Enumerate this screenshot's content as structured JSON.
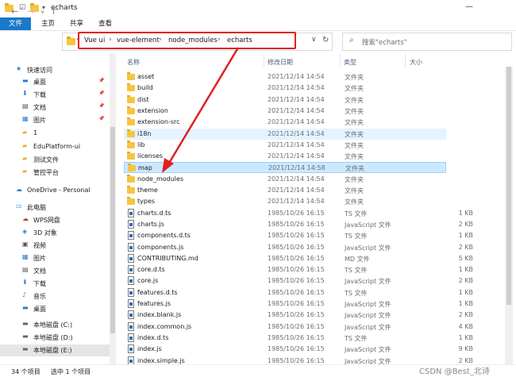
{
  "window": {
    "title": "echarts"
  },
  "ribbon": {
    "tabs": [
      "文件",
      "主页",
      "共享",
      "查看"
    ]
  },
  "address": {
    "crumbs": [
      "Vue ui",
      "vue-element",
      "node_modules",
      "echarts"
    ],
    "search_placeholder": "搜索\"echarts\""
  },
  "sidebar": {
    "items": [
      {
        "label": "快速访问",
        "icon": "star-icon",
        "pin": false
      },
      {
        "label": "桌面",
        "icon": "desktop-icon",
        "pin": true
      },
      {
        "label": "下载",
        "icon": "download-icon",
        "pin": true
      },
      {
        "label": "文档",
        "icon": "document-icon",
        "pin": true
      },
      {
        "label": "图片",
        "icon": "picture-icon",
        "pin": true
      },
      {
        "label": "1",
        "icon": "folder-icon",
        "pin": false
      },
      {
        "label": "EduPlatform-ui",
        "icon": "folder-icon",
        "pin": false
      },
      {
        "label": "测试文件",
        "icon": "folder-icon",
        "pin": false
      },
      {
        "label": "管控平台",
        "icon": "folder-icon",
        "pin": false
      },
      {
        "label": "OneDrive - Personal",
        "icon": "cloud-icon",
        "pin": false
      },
      {
        "label": "此电脑",
        "icon": "computer-icon",
        "pin": false
      },
      {
        "label": "WPS网盘",
        "icon": "cloud-drive-icon",
        "pin": false
      },
      {
        "label": "3D 对象",
        "icon": "cube-icon",
        "pin": false
      },
      {
        "label": "视频",
        "icon": "video-icon",
        "pin": false
      },
      {
        "label": "图片",
        "icon": "picture-icon",
        "pin": false
      },
      {
        "label": "文档",
        "icon": "document-icon",
        "pin": false
      },
      {
        "label": "下载",
        "icon": "download-icon",
        "pin": false
      },
      {
        "label": "音乐",
        "icon": "music-icon",
        "pin": false
      },
      {
        "label": "桌面",
        "icon": "desktop-icon",
        "pin": false
      },
      {
        "label": "本地磁盘 (C:)",
        "icon": "drive-icon",
        "pin": false
      },
      {
        "label": "本地磁盘 (D:)",
        "icon": "drive-icon",
        "pin": false
      },
      {
        "label": "本地磁盘 (E:)",
        "icon": "drive-icon",
        "pin": false
      }
    ]
  },
  "columns": {
    "name": "名称",
    "date": "修改日期",
    "type": "类型",
    "size": "大小"
  },
  "files": [
    {
      "name": "asset",
      "date": "2021/12/14 14:54",
      "type": "文件夹",
      "size": "",
      "kind": "folder"
    },
    {
      "name": "build",
      "date": "2021/12/14 14:54",
      "type": "文件夹",
      "size": "",
      "kind": "folder"
    },
    {
      "name": "dist",
      "date": "2021/12/14 14:54",
      "type": "文件夹",
      "size": "",
      "kind": "folder"
    },
    {
      "name": "extension",
      "date": "2021/12/14 14:54",
      "type": "文件夹",
      "size": "",
      "kind": "folder"
    },
    {
      "name": "extension-src",
      "date": "2021/12/14 14:54",
      "type": "文件夹",
      "size": "",
      "kind": "folder"
    },
    {
      "name": "i18n",
      "date": "2021/12/14 14:54",
      "type": "文件夹",
      "size": "",
      "kind": "folder",
      "state": "hover"
    },
    {
      "name": "lib",
      "date": "2021/12/14 14:54",
      "type": "文件夹",
      "size": "",
      "kind": "folder"
    },
    {
      "name": "licenses",
      "date": "2021/12/14 14:54",
      "type": "文件夹",
      "size": "",
      "kind": "folder"
    },
    {
      "name": "map",
      "date": "2021/12/14 14:58",
      "type": "文件夹",
      "size": "",
      "kind": "folder",
      "state": "selected"
    },
    {
      "name": "node_modules",
      "date": "2021/12/14 14:54",
      "type": "文件夹",
      "size": "",
      "kind": "folder"
    },
    {
      "name": "theme",
      "date": "2021/12/14 14:54",
      "type": "文件夹",
      "size": "",
      "kind": "folder"
    },
    {
      "name": "types",
      "date": "2021/12/14 14:54",
      "type": "文件夹",
      "size": "",
      "kind": "folder"
    },
    {
      "name": "charts.d.ts",
      "date": "1985/10/26 16:15",
      "type": "TS 文件",
      "size": "1 KB",
      "kind": "file"
    },
    {
      "name": "charts.js",
      "date": "1985/10/26 16:15",
      "type": "JavaScript 文件",
      "size": "2 KB",
      "kind": "file"
    },
    {
      "name": "components.d.ts",
      "date": "1985/10/26 16:15",
      "type": "TS 文件",
      "size": "1 KB",
      "kind": "file"
    },
    {
      "name": "components.js",
      "date": "1985/10/26 16:15",
      "type": "JavaScript 文件",
      "size": "2 KB",
      "kind": "file"
    },
    {
      "name": "CONTRIBUTING.md",
      "date": "1985/10/26 16:15",
      "type": "MD 文件",
      "size": "5 KB",
      "kind": "file"
    },
    {
      "name": "core.d.ts",
      "date": "1985/10/26 16:15",
      "type": "TS 文件",
      "size": "1 KB",
      "kind": "file"
    },
    {
      "name": "core.js",
      "date": "1985/10/26 16:15",
      "type": "JavaScript 文件",
      "size": "2 KB",
      "kind": "file"
    },
    {
      "name": "features.d.ts",
      "date": "1985/10/26 16:15",
      "type": "TS 文件",
      "size": "1 KB",
      "kind": "file"
    },
    {
      "name": "features.js",
      "date": "1985/10/26 16:15",
      "type": "JavaScript 文件",
      "size": "1 KB",
      "kind": "file"
    },
    {
      "name": "index.blank.js",
      "date": "1985/10/26 16:15",
      "type": "JavaScript 文件",
      "size": "2 KB",
      "kind": "file"
    },
    {
      "name": "index.common.js",
      "date": "1985/10/26 16:15",
      "type": "JavaScript 文件",
      "size": "4 KB",
      "kind": "file"
    },
    {
      "name": "index.d.ts",
      "date": "1985/10/26 16:15",
      "type": "TS 文件",
      "size": "1 KB",
      "kind": "file"
    },
    {
      "name": "index.js",
      "date": "1985/10/26 16:15",
      "type": "JavaScript 文件",
      "size": "9 KB",
      "kind": "file"
    },
    {
      "name": "index.simple.js",
      "date": "1985/10/26 16:15",
      "type": "JavaScript 文件",
      "size": "2 KB",
      "kind": "file"
    }
  ],
  "status": {
    "count": "34 个项目",
    "selected": "选中 1 个项目"
  },
  "watermark": "CSDN @Best_北诗",
  "colors": {
    "accent": "#1979ca",
    "highlight": "#e02020",
    "selection": "#cce8ff"
  }
}
